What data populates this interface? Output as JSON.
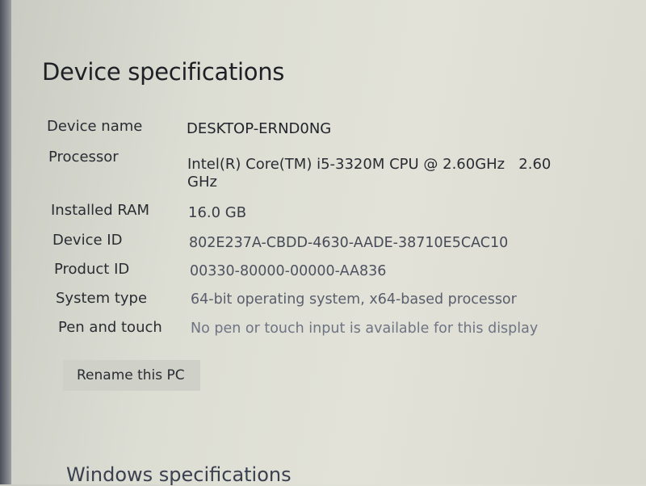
{
  "section_title": "Device specifications",
  "specs": [
    {
      "label": "Device name",
      "value": "DESKTOP-ERND0NG"
    },
    {
      "label": "Processor",
      "value": "Intel(R) Core(TM) i5-3320M CPU @ 2.60GHz   2.60",
      "value_cont": "GHz"
    },
    {
      "label": "Installed RAM",
      "value": "16.0 GB"
    },
    {
      "label": "Device ID",
      "value": "802E237A-CBDD-4630-AADE-38710E5CAC10"
    },
    {
      "label": "Product ID",
      "value": "00330-80000-00000-AA836"
    },
    {
      "label": "System type",
      "value": "64-bit operating system, x64-based processor"
    },
    {
      "label": "Pen and touch",
      "value": "No pen or touch input is available for this display"
    }
  ],
  "rename_button": "Rename this PC",
  "next_section_title": "Windows specifications"
}
